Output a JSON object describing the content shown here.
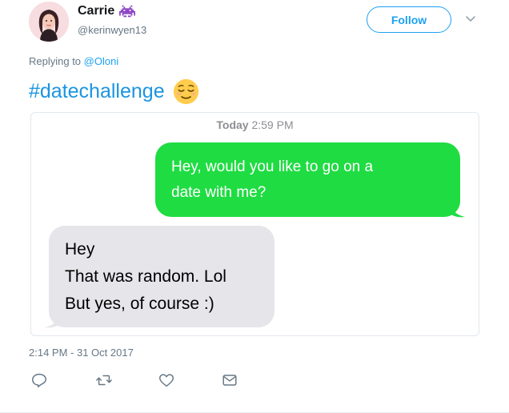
{
  "author": {
    "display_name": "Carrie",
    "name_icon": "space-invader-icon",
    "handle": "@kerinwyen13",
    "avatar_icon": "avatar-illustration"
  },
  "header": {
    "follow_label": "Follow",
    "menu_icon": "chevron-down-icon"
  },
  "reply": {
    "prefix": "Replying to",
    "mention": "@Oloni"
  },
  "tweet": {
    "text": "#datechallenge",
    "emoji": "relieved-face-emoji"
  },
  "media": {
    "time_day": "Today",
    "time_clock": "2:59 PM",
    "sent_message": [
      "Hey, would you like to go on a",
      "date with me?"
    ],
    "received_message": [
      "Hey",
      "That was random. Lol",
      "But yes, of course :)"
    ],
    "sent_color": "#1fdc42",
    "received_color": "#e5e5ea"
  },
  "timestamp": "2:14 PM - 31 Oct 2017",
  "actions": [
    "reply-icon",
    "retweet-icon",
    "like-icon",
    "direct-message-icon"
  ],
  "colors": {
    "accent": "#1da1f2",
    "hashtag": "#1b95e0",
    "secondary_text": "#657786"
  }
}
